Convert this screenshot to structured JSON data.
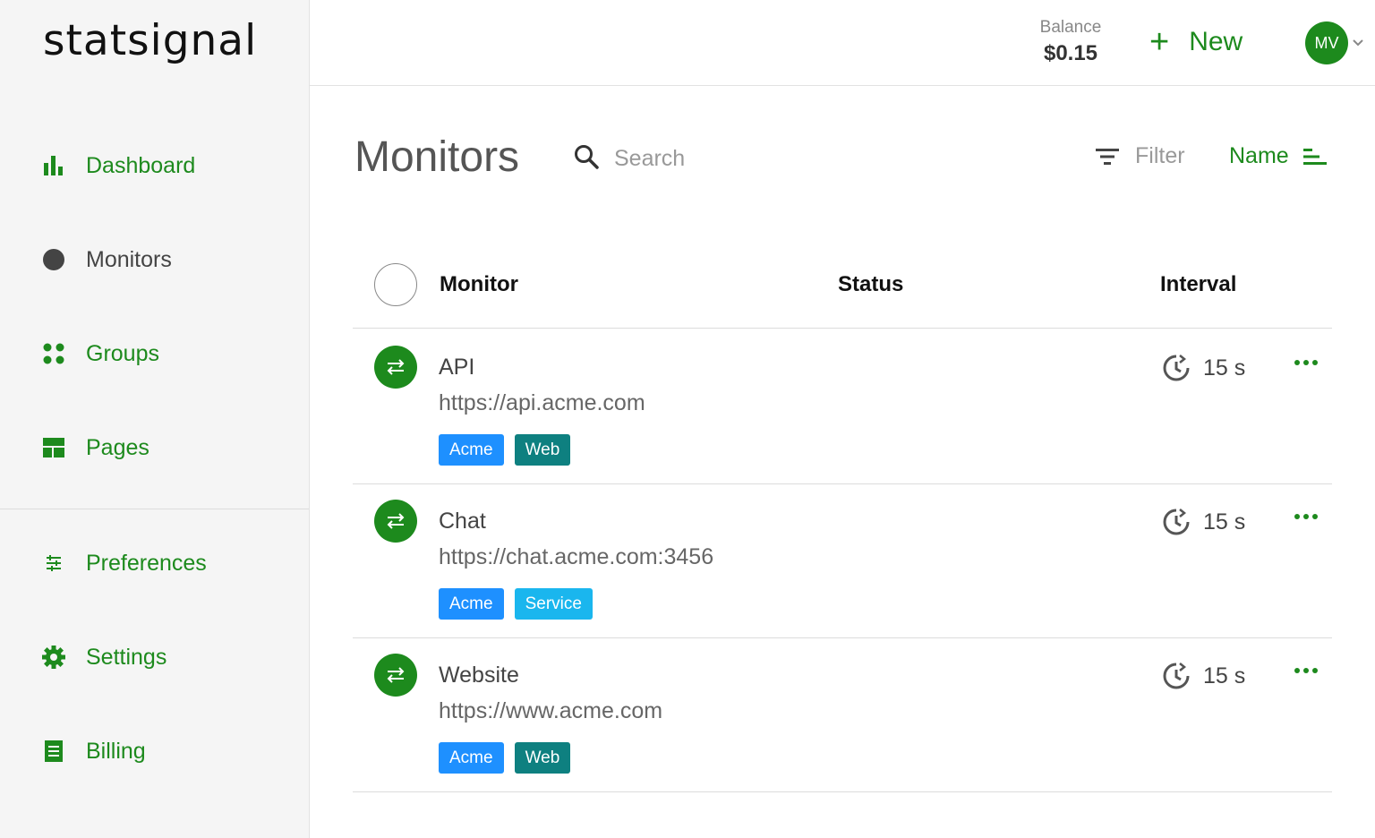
{
  "brand": {
    "logo_text": "statsignal"
  },
  "sidebar": {
    "items": [
      {
        "label": "Dashboard",
        "icon": "bar-chart-icon"
      },
      {
        "label": "Monitors",
        "icon": "circle-icon"
      },
      {
        "label": "Groups",
        "icon": "dots-grid-icon"
      },
      {
        "label": "Pages",
        "icon": "layout-icon"
      },
      {
        "label": "Preferences",
        "icon": "sliders-icon"
      },
      {
        "label": "Settings",
        "icon": "gear-icon"
      },
      {
        "label": "Billing",
        "icon": "receipt-icon"
      }
    ]
  },
  "header": {
    "balance_label": "Balance",
    "balance_value": "$0.15",
    "new_label": "New",
    "avatar_initials": "MV"
  },
  "main": {
    "title": "Monitors",
    "search_placeholder": "Search",
    "filter_label": "Filter",
    "sort_label": "Name",
    "columns": {
      "monitor": "Monitor",
      "status": "Status",
      "interval": "Interval"
    },
    "rows": [
      {
        "name": "API",
        "url": "https://api.acme.com",
        "tags": [
          {
            "label": "Acme"
          },
          {
            "label": "Web"
          }
        ],
        "interval": "15 s"
      },
      {
        "name": "Chat",
        "url": "https://chat.acme.com:3456",
        "tags": [
          {
            "label": "Acme"
          },
          {
            "label": "Service"
          }
        ],
        "interval": "15 s"
      },
      {
        "name": "Website",
        "url": "https://www.acme.com",
        "tags": [
          {
            "label": "Acme"
          },
          {
            "label": "Web"
          }
        ],
        "interval": "15 s"
      }
    ]
  },
  "colors": {
    "accent": "#1d8a1d",
    "tag_acme": "#1e90ff",
    "tag_web": "#0e8080",
    "tag_service": "#1ab6ee"
  }
}
